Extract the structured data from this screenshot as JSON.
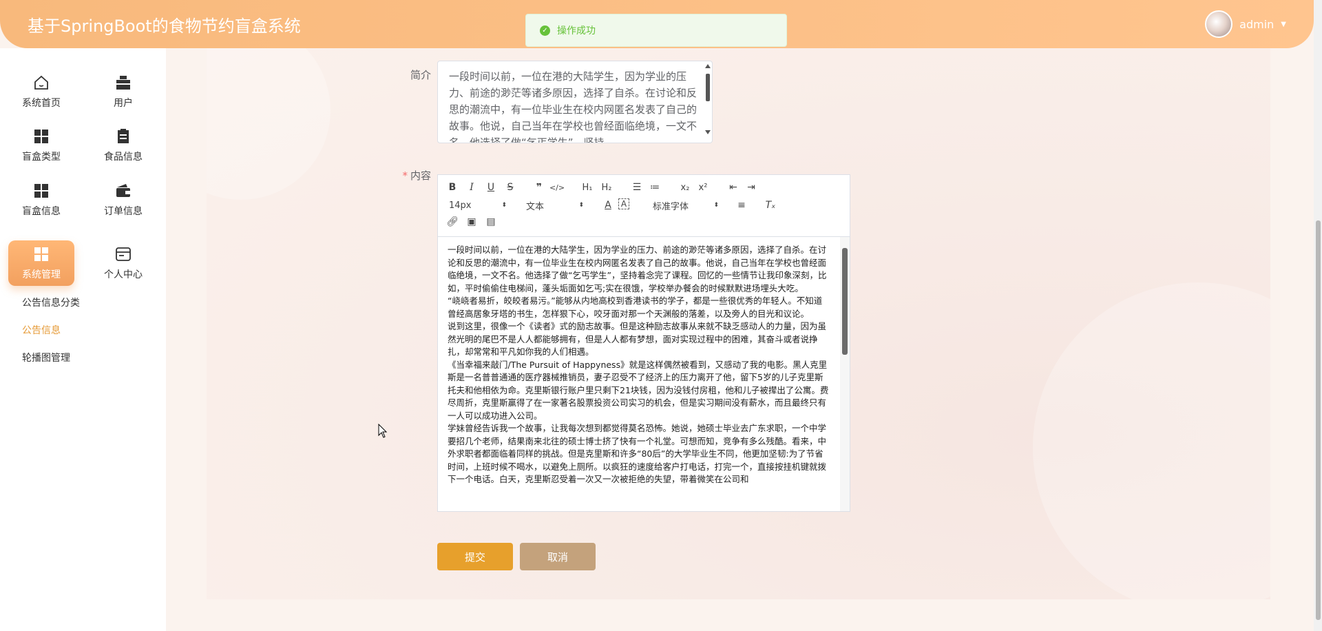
{
  "header": {
    "title": "基于SpringBoot的食物节约盲盒系统",
    "username": "admin"
  },
  "toast": {
    "message": "操作成功"
  },
  "sidebar": {
    "items": [
      {
        "label": "系统首页",
        "icon": "home-icon"
      },
      {
        "label": "用户",
        "icon": "briefcase-icon"
      },
      {
        "label": "盲盒类型",
        "icon": "grid-icon"
      },
      {
        "label": "食品信息",
        "icon": "clipboard-icon"
      },
      {
        "label": "盲盒信息",
        "icon": "grid-icon"
      },
      {
        "label": "订单信息",
        "icon": "wallet-icon"
      },
      {
        "label": "系统管理",
        "icon": "grid-icon"
      },
      {
        "label": "个人中心",
        "icon": "card-icon"
      }
    ],
    "submenu": [
      {
        "label": "公告信息分类"
      },
      {
        "label": "公告信息"
      },
      {
        "label": "轮播图管理"
      }
    ]
  },
  "form": {
    "summary_label": "简介",
    "summary_text": "一段时间以前，一位在港的大陆学生，因为学业的压力、前途的渺茫等诸多原因，选择了自杀。在讨论和反思的潮流中，有一位毕业生在校内网匿名发表了自己的故事。他说，自己当年在学校也曾经面临绝境，一文不名，他选择了做“乞丐学生”，坚持",
    "content_label": "内容",
    "content_required_mark": "*",
    "content_paragraphs": [
      "一段时间以前，一位在港的大陆学生，因为学业的压力、前途的渺茫等诸多原因，选择了自杀。在讨论和反思的潮流中，有一位毕业生在校内网匿名发表了自己的故事。他说，自己当年在学校也曾经面临绝境，一文不名。他选择了做“乞丐学生”，坚持着念完了课程。回忆的一些情节让我印象深刻，比如，平时偷偷住电梯间，蓬头垢面如乞丐;实在很饿，学校举办餐会的时候默默进场埋头大吃。",
      "“峣峣者易折，皎皎者易污。”能够从内地高校到香港读书的学子，都是一些很优秀的年轻人。不知道曾经高居象牙塔的书生，怎样狠下心，咬牙面对那一个天渊般的落差，以及旁人的目光和议论。",
      "说到这里，很像一个《读者》式的励志故事。但是这种励志故事从来就不缺乏感动人的力量，因为虽然光明的尾巴不是人人都能够拥有，但是人人都有梦想，面对实现过程中的困难，其奋斗或者说挣扎，却常常和平凡如你我的人们相遇。",
      "《当幸福来敲门/The Pursuit of Happyness》就是这样偶然被看到，又感动了我的电影。黑人克里斯是一名普普通通的医疗器械推销员，妻子忍受不了经济上的压力离开了他，留下5岁的儿子克里斯托夫和他相依为命。克里斯银行账户里只剩下21块钱，因为没钱付房租，他和儿子被撵出了公寓。费尽周折，克里斯赢得了在一家著名股票投资公司实习的机会，但是实习期间没有薪水，而且最终只有一人可以成功进入公司。",
      "学妹曾经告诉我一个故事，让我每次想到都觉得莫名恐怖。她说，她硕士毕业去广东求职，一个中学要招几个老师，结果南来北往的硕士博士挤了快有一个礼堂。可想而知，竞争有多么残酷。看来，中外求职者都面临着同样的挑战。但是克里斯和许多“80后”的大学毕业生不同，他更加坚韧:为了节省时间，上班时候不喝水，以避免上厕所。以疯狂的速度给客户打电话，打完一个，直接按挂机键就拨下一个电话。白天，克里斯忍受着一次又一次被拒绝的失望，带着微笑在公司和"
    ]
  },
  "toolbar": {
    "font_size": "14px",
    "block_format": "文本",
    "font_family": "标准字体"
  },
  "buttons": {
    "submit": "提交",
    "cancel": "取消"
  }
}
